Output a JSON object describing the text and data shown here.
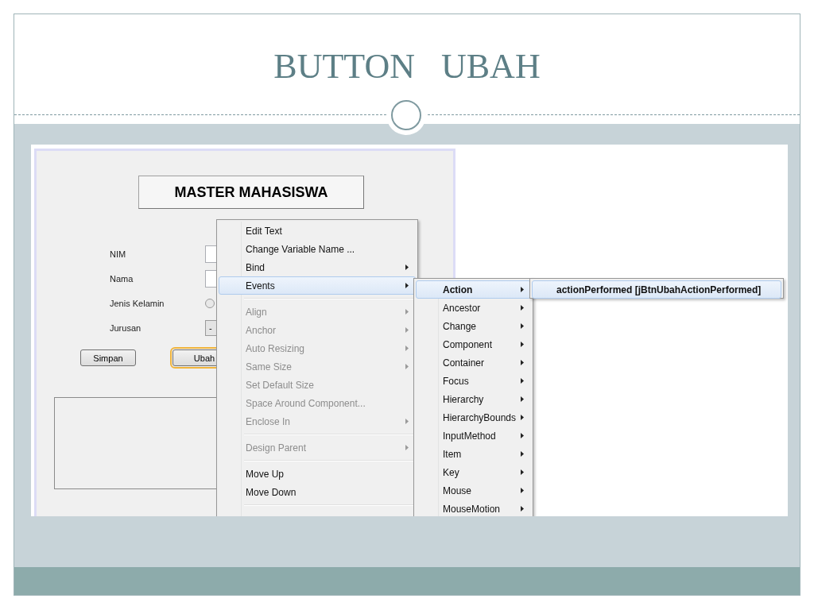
{
  "slide": {
    "title": "BUTTON   UBAH"
  },
  "form": {
    "title": "MASTER MAHASISWA",
    "fields": [
      {
        "label": "NIM",
        "kind": "text"
      },
      {
        "label": "Nama",
        "kind": "text"
      },
      {
        "label": "Jenis Kelamin",
        "kind": "radio",
        "checked": false
      },
      {
        "label": "Jurusan",
        "kind": "combo",
        "value": "-"
      }
    ],
    "buttons": [
      {
        "label": "Simpan",
        "selected": false
      },
      {
        "label": "Ubah",
        "selected": true
      }
    ]
  },
  "context_menu": {
    "items": [
      {
        "kind": "item",
        "label": "Edit Text",
        "disabled": false,
        "selected": false,
        "submenu": false
      },
      {
        "kind": "item",
        "label": "Change Variable Name ...",
        "disabled": false,
        "selected": false,
        "submenu": false
      },
      {
        "kind": "item",
        "label": "Bind",
        "disabled": false,
        "selected": false,
        "submenu": true
      },
      {
        "kind": "item",
        "label": "Events",
        "disabled": false,
        "selected": true,
        "submenu": true
      },
      {
        "kind": "separator"
      },
      {
        "kind": "item",
        "label": "Align",
        "disabled": true,
        "selected": false,
        "submenu": true
      },
      {
        "kind": "item",
        "label": "Anchor",
        "disabled": true,
        "selected": false,
        "submenu": true
      },
      {
        "kind": "item",
        "label": "Auto Resizing",
        "disabled": true,
        "selected": false,
        "submenu": true
      },
      {
        "kind": "item",
        "label": "Same Size",
        "disabled": true,
        "selected": false,
        "submenu": true
      },
      {
        "kind": "item",
        "label": "Set Default Size",
        "disabled": true,
        "selected": false,
        "submenu": false
      },
      {
        "kind": "item",
        "label": "Space Around Component...",
        "disabled": true,
        "selected": false,
        "submenu": false
      },
      {
        "kind": "item",
        "label": "Enclose In",
        "disabled": true,
        "selected": false,
        "submenu": true
      },
      {
        "kind": "separator"
      },
      {
        "kind": "item",
        "label": "Design Parent",
        "disabled": true,
        "selected": false,
        "submenu": true
      },
      {
        "kind": "separator"
      },
      {
        "kind": "item",
        "label": "Move Up",
        "disabled": false,
        "selected": false,
        "submenu": false
      },
      {
        "kind": "item",
        "label": "Move Down",
        "disabled": false,
        "selected": false,
        "submenu": false
      },
      {
        "kind": "separator"
      }
    ]
  },
  "events_menu": {
    "items": [
      {
        "kind": "item",
        "label": "Action",
        "disabled": false,
        "selected": true,
        "submenu": true
      },
      {
        "kind": "item",
        "label": "Ancestor",
        "disabled": false,
        "selected": false,
        "submenu": true
      },
      {
        "kind": "item",
        "label": "Change",
        "disabled": false,
        "selected": false,
        "submenu": true
      },
      {
        "kind": "item",
        "label": "Component",
        "disabled": false,
        "selected": false,
        "submenu": true
      },
      {
        "kind": "item",
        "label": "Container",
        "disabled": false,
        "selected": false,
        "submenu": true
      },
      {
        "kind": "item",
        "label": "Focus",
        "disabled": false,
        "selected": false,
        "submenu": true
      },
      {
        "kind": "item",
        "label": "Hierarchy",
        "disabled": false,
        "selected": false,
        "submenu": true
      },
      {
        "kind": "item",
        "label": "HierarchyBounds",
        "disabled": false,
        "selected": false,
        "submenu": true
      },
      {
        "kind": "item",
        "label": "InputMethod",
        "disabled": false,
        "selected": false,
        "submenu": true
      },
      {
        "kind": "item",
        "label": "Item",
        "disabled": false,
        "selected": false,
        "submenu": true
      },
      {
        "kind": "item",
        "label": "Key",
        "disabled": false,
        "selected": false,
        "submenu": true
      },
      {
        "kind": "item",
        "label": "Mouse",
        "disabled": false,
        "selected": false,
        "submenu": true
      },
      {
        "kind": "item",
        "label": "MouseMotion",
        "disabled": false,
        "selected": false,
        "submenu": true
      }
    ]
  },
  "action_menu": {
    "items": [
      {
        "kind": "item",
        "label": "actionPerformed [jBtnUbahActionPerformed]",
        "disabled": false,
        "selected": true,
        "submenu": false
      }
    ]
  }
}
